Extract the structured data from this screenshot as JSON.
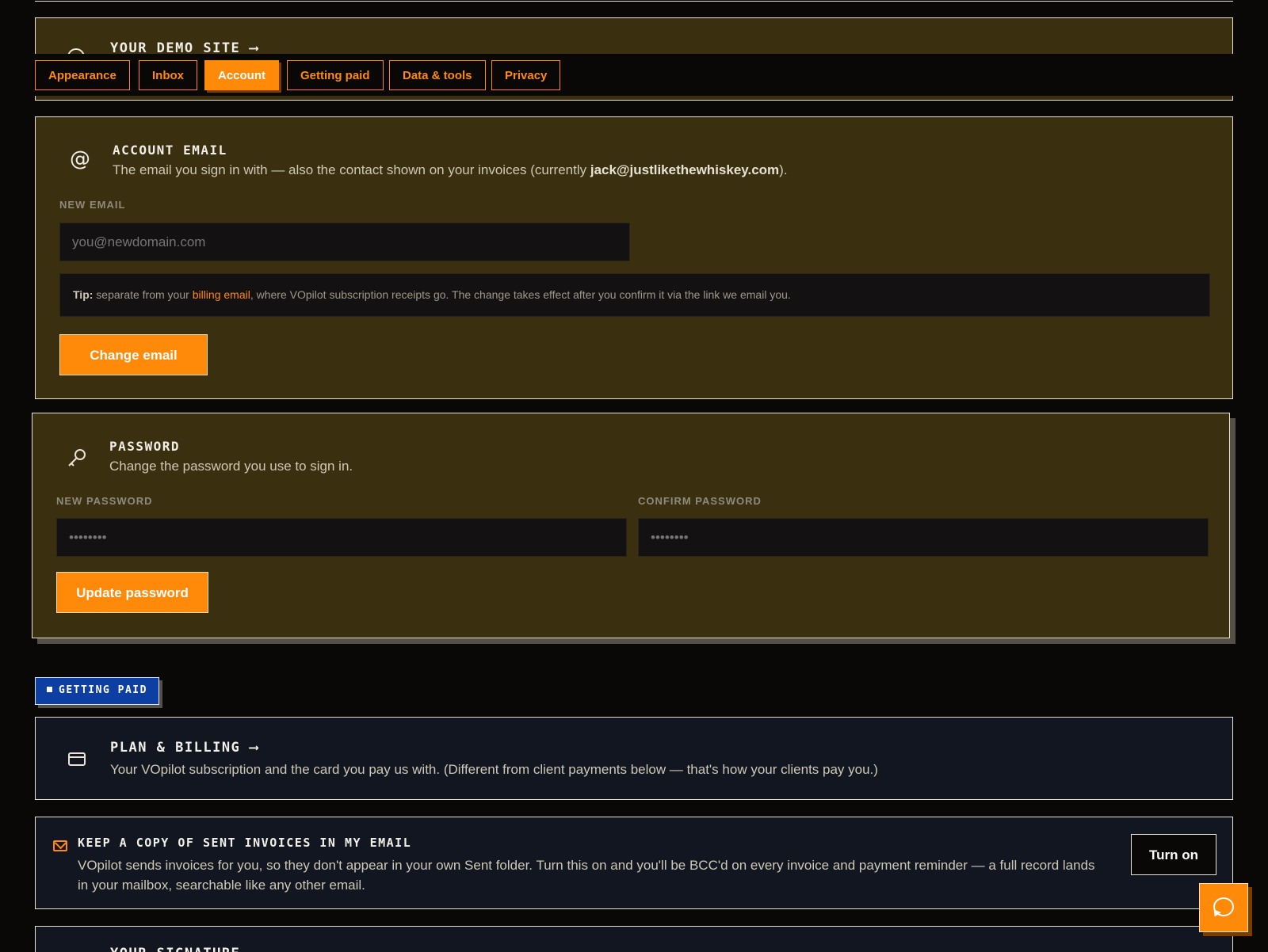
{
  "demo_site": {
    "title": "YOUR DEMO SITE",
    "arrow": "⟶"
  },
  "tabs": [
    {
      "label": "Appearance",
      "active": false
    },
    {
      "label": "Inbox",
      "active": false
    },
    {
      "label": "Account",
      "active": true
    },
    {
      "label": "Getting paid",
      "active": false
    },
    {
      "label": "Data & tools",
      "active": false
    },
    {
      "label": "Privacy",
      "active": false
    }
  ],
  "account_email": {
    "icon": "at-icon",
    "title": "ACCOUNT EMAIL",
    "desc_prefix": "The email you sign in with — also the contact shown on your invoices (currently ",
    "current_email": "jack@justlikethewhiskey.com",
    "desc_suffix": ").",
    "field_label": "NEW EMAIL",
    "placeholder": "you@newdomain.com",
    "tip_label": "Tip:",
    "tip_before": " separate from your ",
    "tip_link": "billing email",
    "tip_after": ", where VOpilot subscription receipts go. The change takes effect after you confirm it via the link we email you.",
    "button": "Change email"
  },
  "password": {
    "icon": "key-icon",
    "title": "PASSWORD",
    "desc": "Change the password you use to sign in.",
    "new_label": "NEW PASSWORD",
    "new_placeholder": "••••••••",
    "confirm_label": "CONFIRM PASSWORD",
    "confirm_placeholder": "••••••••",
    "button": "Update password"
  },
  "section_label": "GETTING PAID",
  "plan_billing": {
    "icon": "credit-card-icon",
    "title": "PLAN & BILLING",
    "arrow": "⟶",
    "desc": "Your VOpilot subscription and the card you pay us with. (Different from client payments below — that's how your clients pay you.)"
  },
  "keep_copy": {
    "icon": "mail-icon",
    "title": "KEEP A COPY OF SENT INVOICES IN MY EMAIL",
    "desc": "VOpilot sends invoices for you, so they don't appear in your own Sent folder. Turn this on and you'll be BCC'd on every invoice and payment reminder — a full record lands in your mailbox, searchable like any other email.",
    "button": "Turn on"
  },
  "signature": {
    "title": "YOUR SIGNATURE"
  },
  "chat": {
    "icon": "chat-bubble-icon"
  },
  "colors": {
    "accent": "#ff8a0a",
    "olive_bg": "#3a2f0f",
    "navy_bg": "#111620",
    "section_blue": "#0d3fa3"
  }
}
